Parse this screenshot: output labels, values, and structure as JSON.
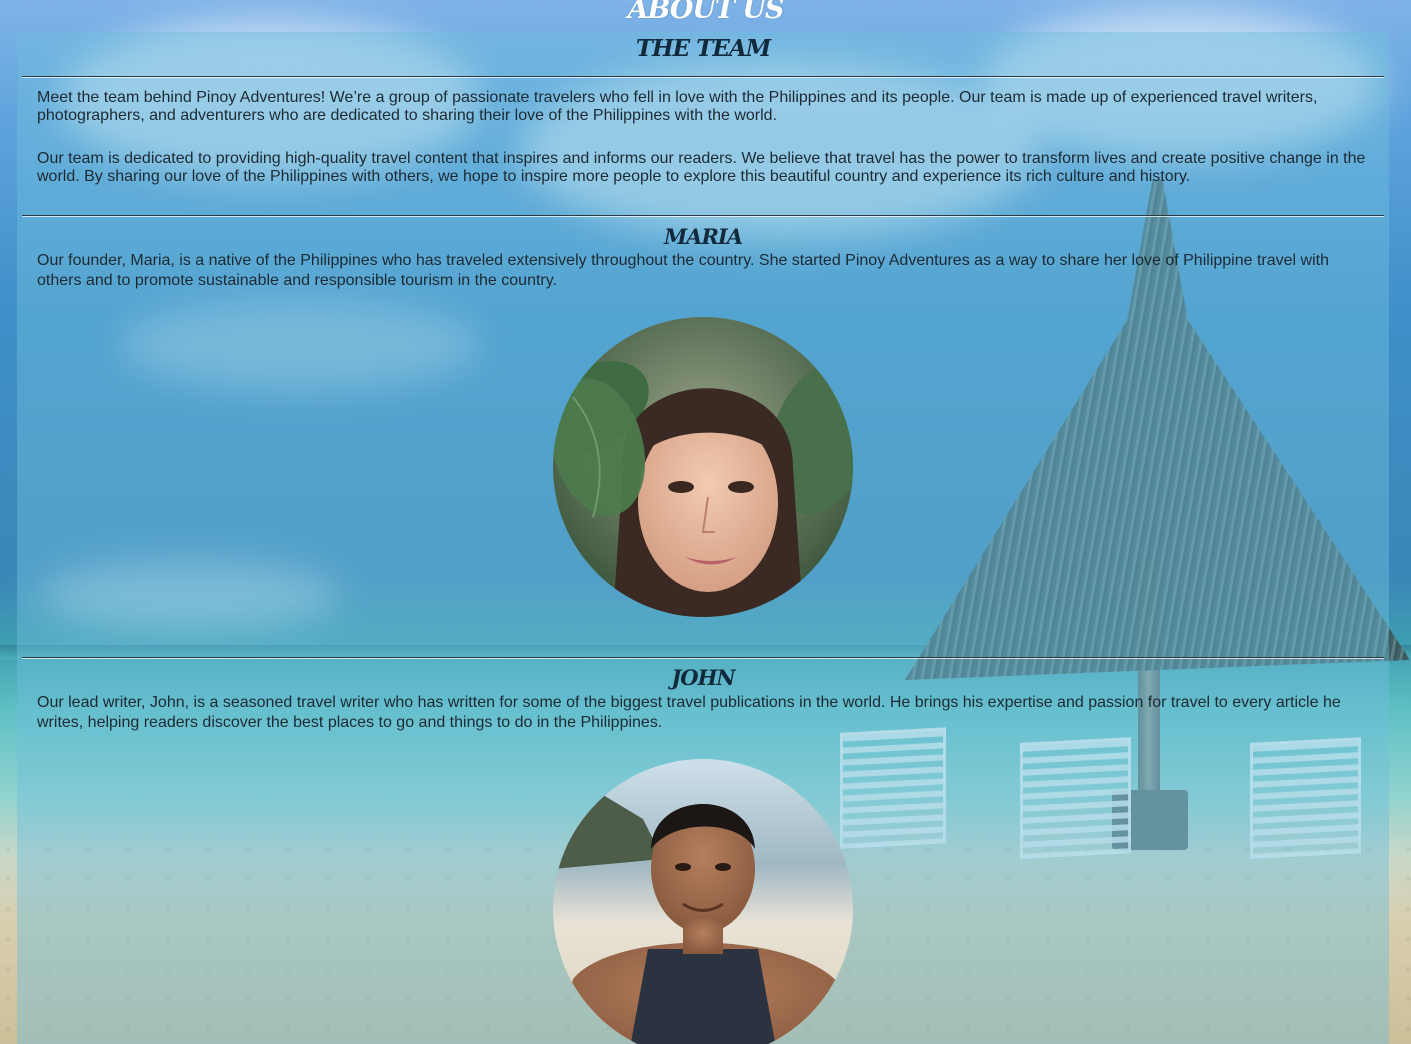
{
  "page": {
    "heading": "ABOUT US"
  },
  "team": {
    "title": "THE TEAM",
    "intro_1": "Meet the team behind Pinoy Adventures! We’re a group of passionate travelers who fell in love with the Philippines and its people. Our team is made up of experienced travel writers, photographers, and adventurers who are dedicated to sharing their love of the Philippines with the world.",
    "intro_2": "Our team is dedicated to providing high-quality travel content that inspires and informs our readers. We believe that travel has the power to transform lives and create positive change in the world. By sharing our love of the Philippines with others, we hope to inspire more people to explore this beautiful country and experience its rich culture and history."
  },
  "members": [
    {
      "name": "MARIA",
      "bio": "Our founder, Maria, is a native of the Philippines who has traveled extensively throughout the country. She started Pinoy Adventures as a way to share her love of Philippine travel with others and to promote sustainable and responsible tourism in the country."
    },
    {
      "name": "JOHN",
      "bio": "Our lead writer, John, is a seasoned travel writer who has written for some of the biggest travel publications in the world. He brings his expertise and passion for travel to every article he writes, helping readers discover the best places to go and things to do in the Philippines."
    }
  ]
}
